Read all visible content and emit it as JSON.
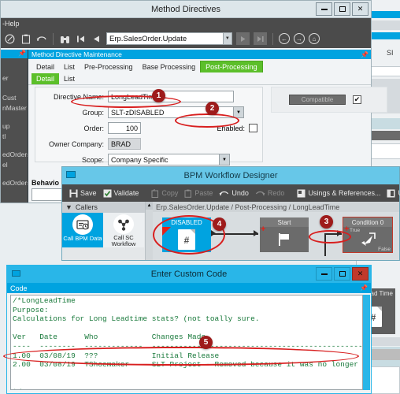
{
  "background": {
    "right_pane_label": "SI",
    "occluded_node_label": "ead Time"
  },
  "method_directives": {
    "title": "Method Directives",
    "menu": "-Help",
    "toolbar": {
      "icons": [
        "clear-icon",
        "clipboard-icon",
        "undo-icon",
        "search-binoculars-icon",
        "first-record-icon",
        "prev-record-icon"
      ],
      "combo_value": "Erp.SalesOrder.Update",
      "nav_icons": [
        "dropdown-arrow-icon",
        "next-record-icon",
        "last-record-icon",
        "back-icon",
        "forward-icon",
        "home-icon"
      ]
    },
    "sidebar": {
      "items": [
        "er",
        "Cust",
        "nMaster",
        "up",
        "tl",
        "edOrders",
        "el",
        "edOrders"
      ]
    },
    "caption": "Method Directive Maintenance",
    "tabs": [
      "Detail",
      "List",
      "Pre-Processing",
      "Base Processing",
      "Post-Processing"
    ],
    "active_tab": "Post-Processing",
    "subtabs": [
      "Detail",
      "List"
    ],
    "active_subtab": "Detail",
    "form": {
      "directive_name_label": "Directive Name:",
      "directive_name_value": "LongLeadTime",
      "group_label": "Group:",
      "group_value": "SLT-zDISABLED",
      "order_label": "Order:",
      "order_value": "100",
      "owner_company_label": "Owner Company:",
      "owner_company_value": "BRAD",
      "scope_label": "Scope:",
      "scope_value": "Company Specific",
      "enabled_label": "Enabled:",
      "enabled_checked": false,
      "compatible_label": "Compatible",
      "compatible_checked": true
    },
    "behavior_label": "Behavio"
  },
  "bpm_designer": {
    "title": "BPM Workflow Designer",
    "toolbar": [
      {
        "label": "Save",
        "icon": "save-icon",
        "enabled": true
      },
      {
        "label": "Validate",
        "icon": "validate-check-icon",
        "enabled": true
      },
      {
        "label": "Copy",
        "icon": "copy-icon",
        "enabled": false
      },
      {
        "label": "Paste",
        "icon": "paste-icon",
        "enabled": false
      },
      {
        "label": "Undo",
        "icon": "undo-icon",
        "enabled": true
      },
      {
        "label": "Redo",
        "icon": "redo-icon",
        "enabled": false
      },
      {
        "label": "Usings & References...",
        "icon": "usings-icon",
        "enabled": true
      },
      {
        "label": "U",
        "icon": "window-icon",
        "enabled": true
      }
    ],
    "callers_header": "Callers",
    "callers": [
      {
        "label": "Call BPM Data",
        "icon": "bpm-data-icon",
        "selected": true
      },
      {
        "label": "Call SC Workflow",
        "icon": "sc-workflow-icon",
        "selected": false
      }
    ],
    "breadcrumb": "Erp.SalesOrder.Update / Post-Processing / LongLeadTime",
    "nodes": [
      {
        "name": "disabled-node",
        "header": "DISABLED",
        "icon": "document-hash-icon",
        "style": "disabled"
      },
      {
        "name": "start-node",
        "header": "Start",
        "icon": "flag-icon",
        "style": "start"
      },
      {
        "name": "condition-node",
        "header": "Condition 0",
        "icon": "arrow-action-icon",
        "style": "condition",
        "true_label": "True",
        "false_label": "False"
      }
    ]
  },
  "custom_code": {
    "title": "Enter Custom Code",
    "caption": "Code",
    "code": "/*LongLeadTime\nPurpose:\nCalculations for Long Leadtime stats? (not toally sure.\n\nVer   Date      Who            Changes Made\n----  --------  -------------  -------------------------------------------------\n1.00  03/08/19  ???            Initial Release\n2.00  03/08/19  TShoemaker     SLT Project - Removed because it was no longer needed\n\n\n*/"
  },
  "annotations": {
    "badges": [
      {
        "number": "1",
        "target": "group-field"
      },
      {
        "number": "2",
        "target": "enabled-checkbox"
      },
      {
        "number": "3",
        "target": "condition-node-link"
      },
      {
        "number": "4",
        "target": "disabled-node"
      },
      {
        "number": "5",
        "target": "code-removal-line"
      }
    ],
    "color": "#d81f1f",
    "badge_color": "#9e1b1b"
  },
  "window_buttons": {
    "minimize": "minimize-icon",
    "maximize": "maximize-icon",
    "close": "✕"
  }
}
